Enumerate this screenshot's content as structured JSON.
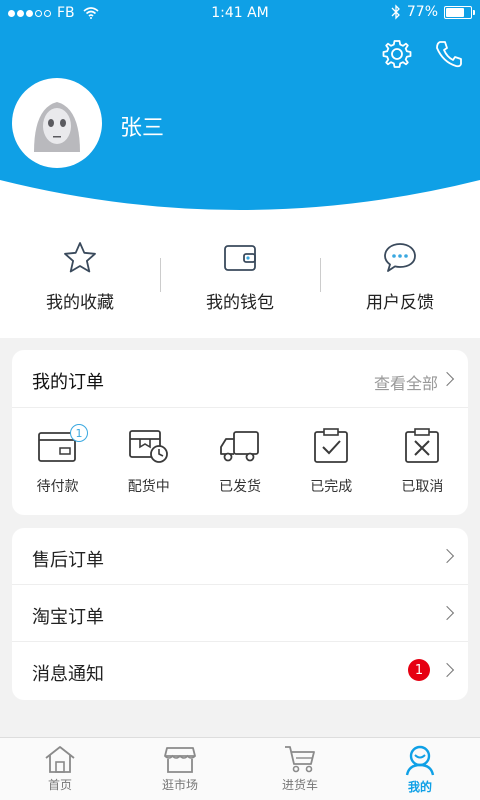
{
  "status_bar": {
    "carrier": "FB",
    "time": "1:41 AM",
    "battery": "77%",
    "battery_level": 0.77
  },
  "header": {
    "username": "张三",
    "bg_color": "#0fa0e6",
    "icons": [
      "gear-icon",
      "phone-icon"
    ]
  },
  "quick_actions": [
    {
      "label": "我的收藏",
      "icon": "star-icon"
    },
    {
      "label": "我的钱包",
      "icon": "wallet-icon"
    },
    {
      "label": "用户反馈",
      "icon": "chat-icon"
    }
  ],
  "orders": {
    "title": "我的订单",
    "view_all": "查看全部",
    "items": [
      {
        "label": "待付款",
        "icon": "payment-icon",
        "badge": "1"
      },
      {
        "label": "配货中",
        "icon": "picking-icon"
      },
      {
        "label": "已发货",
        "icon": "truck-icon"
      },
      {
        "label": "已完成",
        "icon": "completed-icon"
      },
      {
        "label": "已取消",
        "icon": "cancelled-icon"
      }
    ]
  },
  "list": [
    {
      "label": "售后订单"
    },
    {
      "label": "淘宝订单"
    },
    {
      "label": "消息通知",
      "badge": "1"
    }
  ],
  "tabs": [
    {
      "label": "首页",
      "icon": "home-icon"
    },
    {
      "label": "逛市场",
      "icon": "store-icon"
    },
    {
      "label": "进货车",
      "icon": "cart-icon"
    },
    {
      "label": "我的",
      "icon": "profile-icon",
      "active": true
    }
  ],
  "colors": {
    "accent": "#0fa0e6",
    "badge_red": "#e60012"
  }
}
